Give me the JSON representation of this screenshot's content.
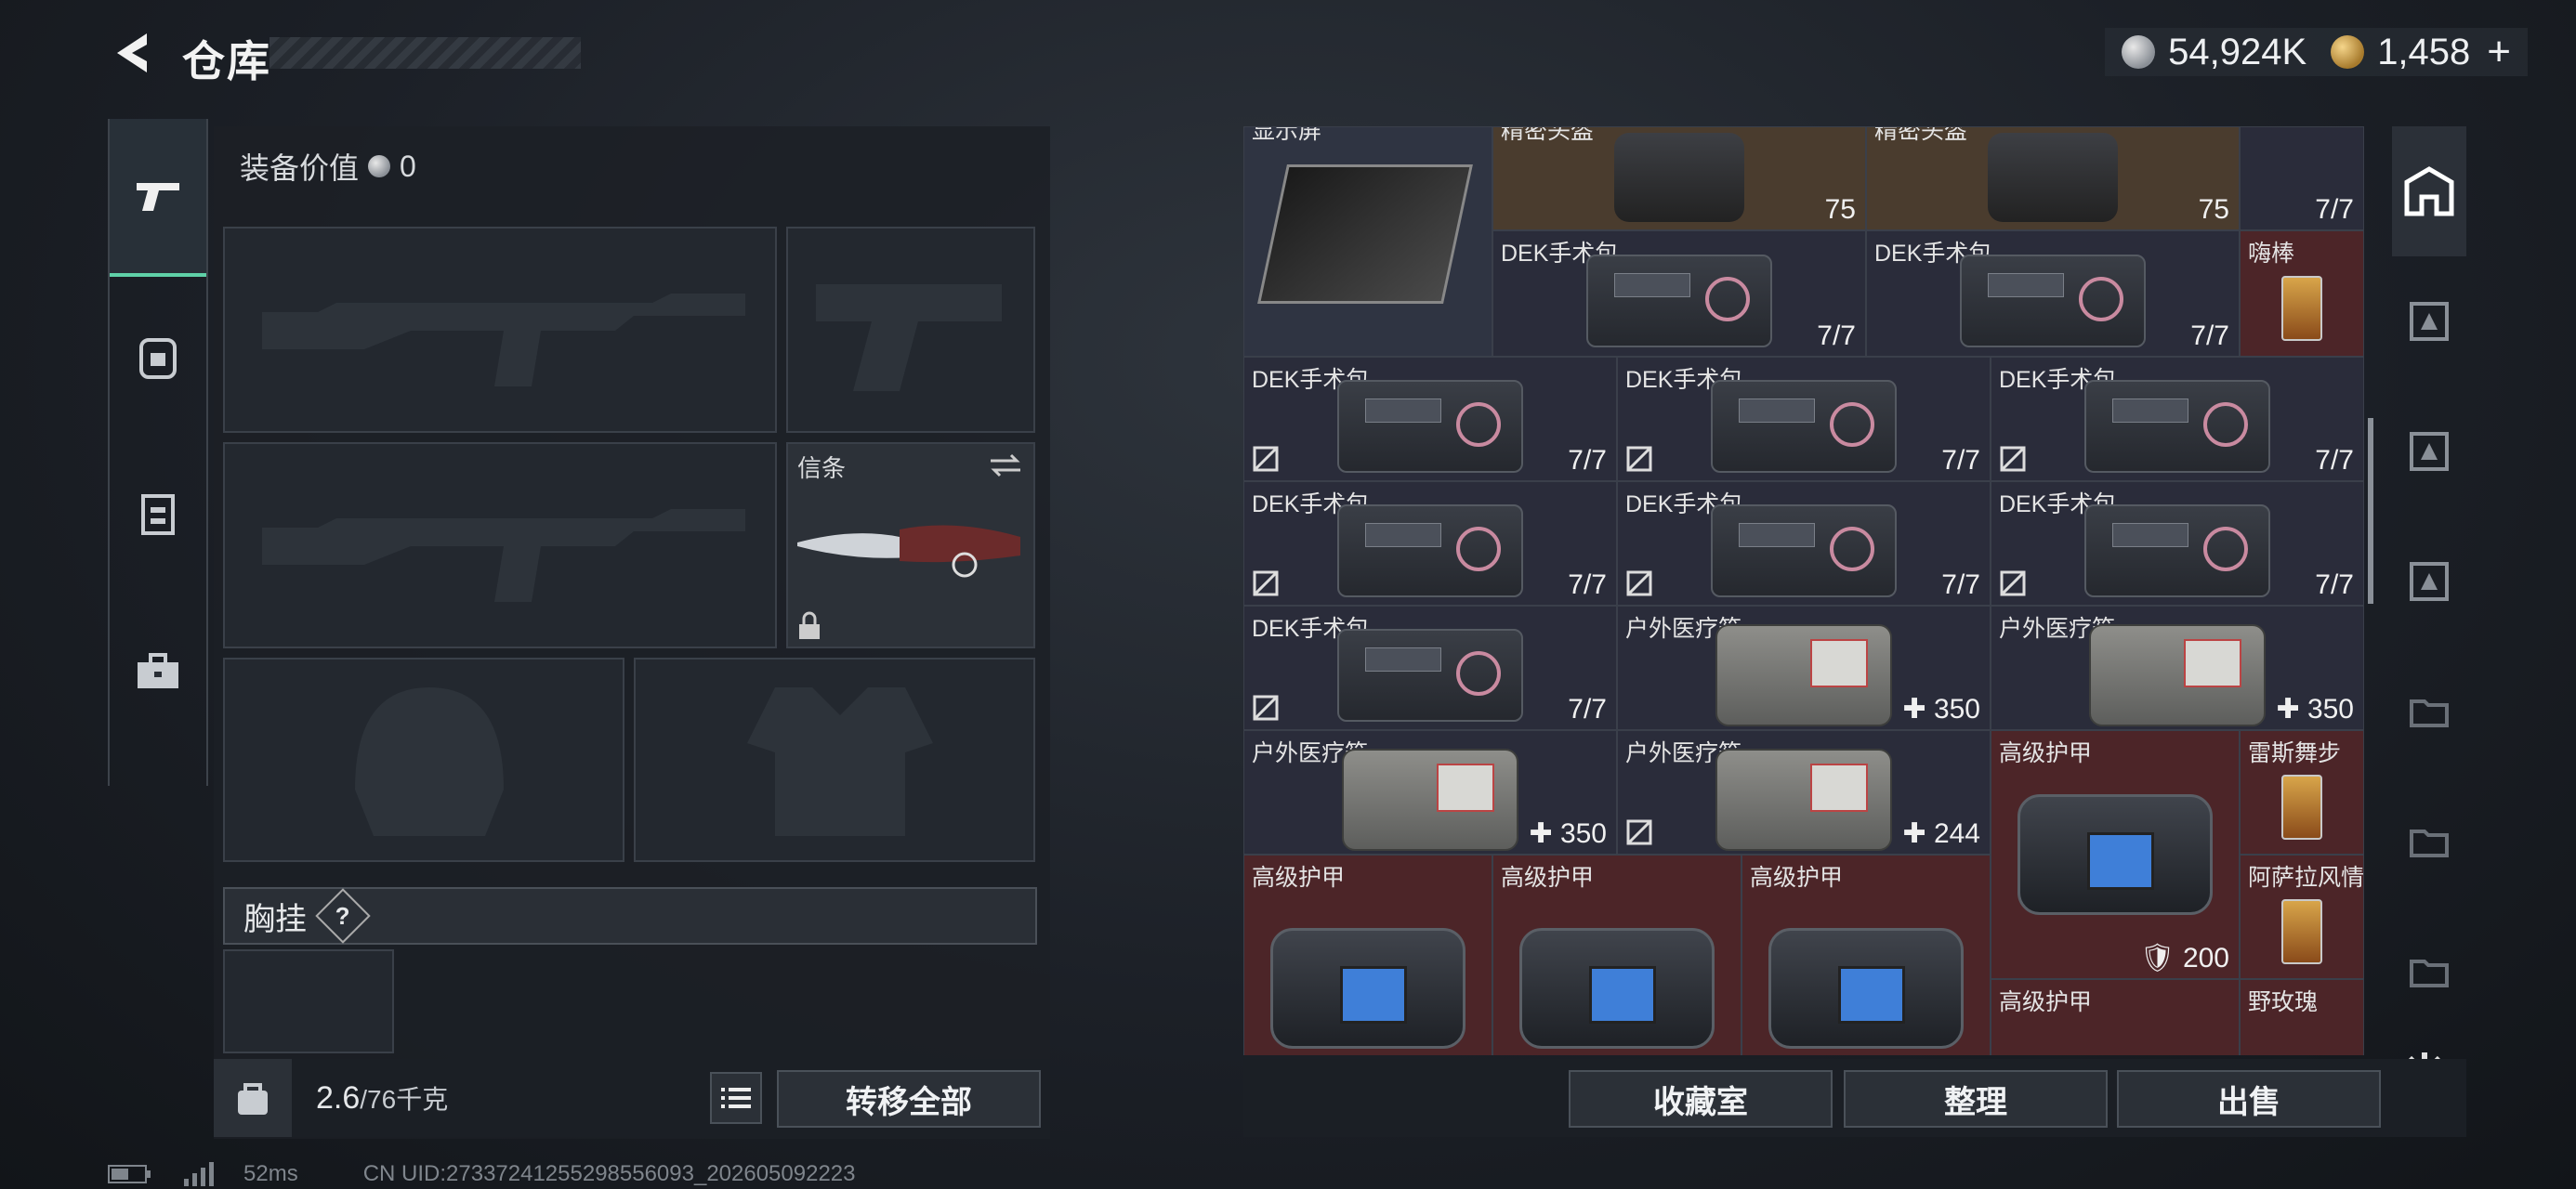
{
  "header": {
    "title": "仓库",
    "silver": "54,924K",
    "gold": "1,458",
    "plus": "+"
  },
  "loadout": {
    "equip_value_label": "装备价值",
    "equip_value": "0",
    "melee_label": "信条",
    "chest_label": "胸挂",
    "chest_help": "?",
    "weight": "2.6",
    "weight_cap": "/76千克",
    "transfer_all": "转移全部"
  },
  "grid": {
    "cells": [
      {
        "name": "显示屏",
        "qty": ""
      },
      {
        "name": "精密头盔",
        "qty": "75"
      },
      {
        "name": "精密头盔",
        "qty": "75"
      },
      {
        "name": "",
        "qty": "7/7"
      },
      {
        "name": "DEK手术包",
        "qty": "7/7"
      },
      {
        "name": "DEK手术包",
        "qty": "7/7"
      },
      {
        "name": "嗨棒",
        "qty": ""
      },
      {
        "name": "DEK手术包",
        "qty": "7/7"
      },
      {
        "name": "DEK手术包",
        "qty": "7/7"
      },
      {
        "name": "DEK手术包",
        "qty": "7/7"
      },
      {
        "name": "DEK手术包",
        "qty": "7/7"
      },
      {
        "name": "DEK手术包",
        "qty": "7/7"
      },
      {
        "name": "DEK手术包",
        "qty": "7/7"
      },
      {
        "name": "DEK手术包",
        "qty": "7/7"
      },
      {
        "name": "户外医疗箱",
        "qty": "350"
      },
      {
        "name": "户外医疗箱",
        "qty": "350"
      },
      {
        "name": "户外医疗箱",
        "qty": "350"
      },
      {
        "name": "户外医疗箱",
        "qty": "244"
      },
      {
        "name": "高级护甲",
        "qty": "200"
      },
      {
        "name": "雷斯舞步",
        "qty": ""
      },
      {
        "name": "高级护甲",
        "qty": ""
      },
      {
        "name": "高级护甲",
        "qty": ""
      },
      {
        "name": "高级护甲",
        "qty": ""
      },
      {
        "name": "阿萨拉风情",
        "qty": ""
      },
      {
        "name": "高级护甲",
        "qty": ""
      },
      {
        "name": "野玫瑰",
        "qty": ""
      }
    ]
  },
  "actions": {
    "collection": "收藏室",
    "sort": "整理",
    "sell": "出售"
  },
  "footer": {
    "ping": "52ms",
    "uid": "CN UID:27337241255298556093_202605092223"
  }
}
